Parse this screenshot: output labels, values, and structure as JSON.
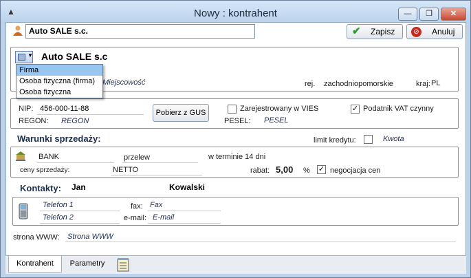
{
  "window": {
    "title": "Nowy : kontrahent",
    "minimize": "—",
    "maximize": "❐",
    "close": "✕"
  },
  "header": {
    "name_value": "Auto SALE s.c.",
    "save_label": "Zapisz",
    "cancel_label": "Anuluj"
  },
  "company": {
    "full_name": "Auto SALE s.c",
    "address_placeholder": "Miejscowość",
    "region_label": "rej.",
    "region_value": "zachodniopomorskie",
    "country_label": "kraj:",
    "country_value": "PL",
    "type_options": [
      "Firma",
      "Osoba fizyczna (firma)",
      "Osoba fizyczna"
    ],
    "type_selected": "Firma"
  },
  "ids": {
    "nip_label": "NIP:",
    "nip_value": "456-000-11-88",
    "gus_button": "Pobierz z GUS",
    "vies_label": "Zarejestrowany w VIES",
    "vies_checked": false,
    "vat_label": "Podatnik VAT czynny",
    "vat_checked": true,
    "regon_label": "REGON:",
    "regon_value": "REGON",
    "pesel_label": "PESEL:",
    "pesel_value": "PESEL"
  },
  "sales": {
    "section_title": "Warunki sprzedaży:",
    "credit_label": "limit kredytu:",
    "credit_checked": false,
    "credit_value": "Kwota",
    "bank": "BANK",
    "payment": "przelew",
    "term": "w terminie 14 dni",
    "prices_label": "ceny sprzedaży:",
    "prices_value": "NETTO",
    "discount_label": "rabat:",
    "discount_value": "5,00",
    "discount_unit": "%",
    "negotiation_label": "negocjacja cen",
    "negotiation_checked": true
  },
  "contacts": {
    "section_title": "Kontakty:",
    "first_name": "Jan",
    "last_name": "Kowalski",
    "phone1": "Telefon 1",
    "phone2": "Telefon 2",
    "fax_label": "fax:",
    "fax_value": "Fax",
    "email_label": "e-mail:",
    "email_value": "E-mail"
  },
  "www": {
    "label": "strona WWW:",
    "value": "Strona WWW"
  },
  "tabs": [
    {
      "label": "Kontrahent"
    },
    {
      "label": "Parametry"
    }
  ],
  "colors": {
    "save_icon": "#2e9b2e",
    "cancel_icon": "#c8281e",
    "selection": "#98c6f0"
  }
}
